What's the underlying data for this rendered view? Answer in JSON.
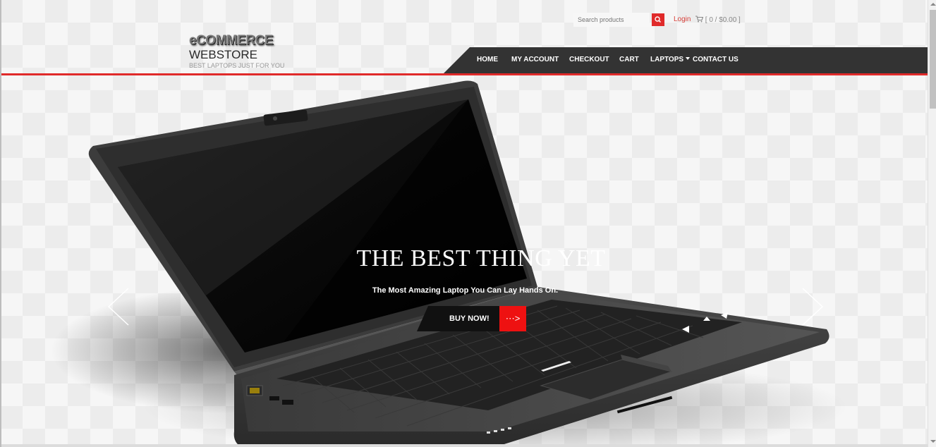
{
  "brand": {
    "logo_text": "eCOMMERCE",
    "name": "WEBSTORE",
    "tagline": "BEST LAPTOPS JUST FOR YOU"
  },
  "search": {
    "placeholder": "Search products"
  },
  "account": {
    "login_label": "Login",
    "cart_summary": "[ 0 / $0.00 ]"
  },
  "nav": {
    "home": "HOME",
    "my_account": "MY ACCOUNT",
    "checkout": "CHECKOUT",
    "cart": "CART",
    "laptops": "LAPTOPS",
    "contact": "CONTACT US"
  },
  "hero": {
    "title": "THE BEST THING YET",
    "subtitle": "The Most Amazing Laptop You Can Lay Hands On.",
    "cta_label": "BUY NOW!",
    "cta_icon": "⋯>"
  },
  "colors": {
    "accent": "#e02a2a",
    "nav_bg": "#333333",
    "cta_red": "#ee1111"
  }
}
